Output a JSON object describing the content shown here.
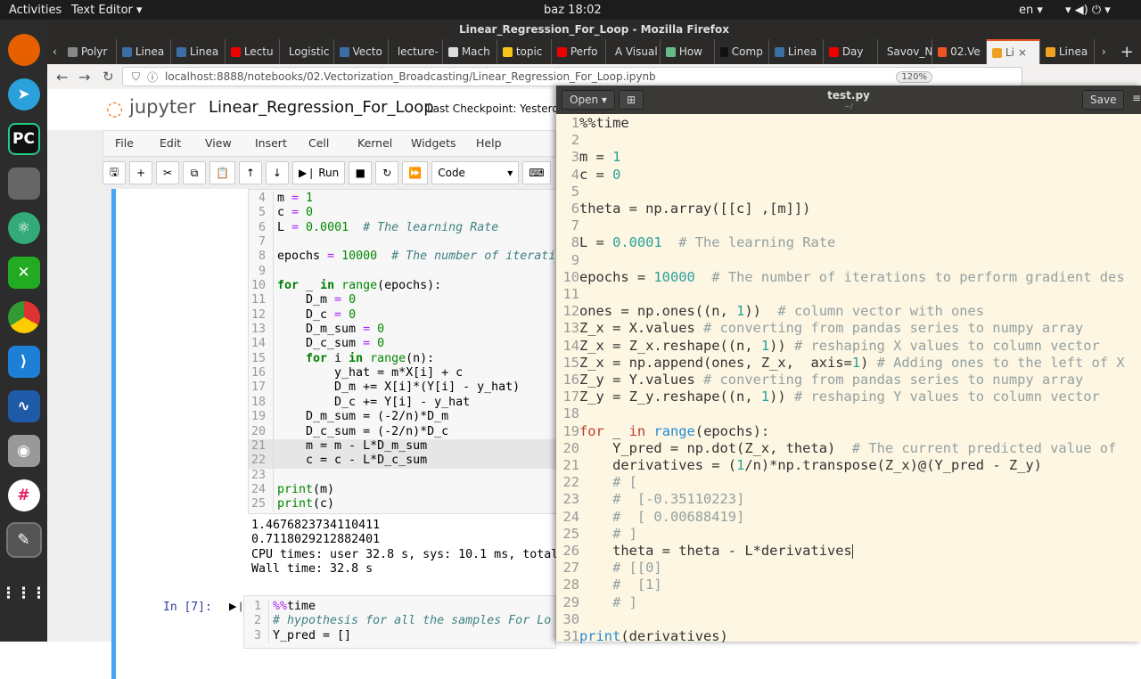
{
  "topbar": {
    "activities": "Activities",
    "app": "Text Editor ▾",
    "clock": "baz 18:02",
    "lang": "en ▾"
  },
  "firefox": {
    "title": "Linear_Regression_For_Loop - Mozilla Firefox",
    "tabs": [
      "Polyr",
      "Linea",
      "Linea",
      "Lectu",
      "Logistic",
      "Vecto",
      "lecture-",
      "Mach",
      "topic",
      "Perfo",
      "A Visual",
      "How",
      "Comp",
      "Linea",
      "Day",
      "Savov_N",
      "02.Ve",
      "Li",
      "Linea"
    ],
    "tab_colors": [
      "#888",
      "#3a6ea5",
      "#3a6ea5",
      "#e00",
      "#888",
      "#3a6ea5",
      "#888",
      "#ddd",
      "#f5c518",
      "#e00",
      "#888",
      "#6b8",
      "#111",
      "#3a6ea5",
      "#e00",
      "#888",
      "#e95420",
      "#f0a020",
      "#f0a020"
    ],
    "url": "localhost:8888/notebooks/02.Vectorization_Broadcasting/Linear_Regression_For_Loop.ipynb",
    "zoom": "120%"
  },
  "jupyter": {
    "logo": "jupyter",
    "notebook": "Linear_Regression_For_Loop",
    "checkpoint": "Last Checkpoint: Yesterda",
    "menu": [
      "File",
      "Edit",
      "View",
      "Insert",
      "Cell",
      "Kernel",
      "Widgets",
      "Help"
    ],
    "run": "Run",
    "cell_type": "Code",
    "cell_lines": [
      {
        "n": "4",
        "s": [
          [
            "",
            "m "
          ],
          [
            "jo",
            "="
          ],
          [
            "",
            " "
          ],
          [
            "jn",
            "1"
          ]
        ]
      },
      {
        "n": "5",
        "s": [
          [
            "",
            "c "
          ],
          [
            "jo",
            "="
          ],
          [
            "",
            " "
          ],
          [
            "jn",
            "0"
          ]
        ]
      },
      {
        "n": "6",
        "s": [
          [
            "",
            "L "
          ],
          [
            "jo",
            "="
          ],
          [
            "",
            " "
          ],
          [
            "jn",
            "0.0001"
          ],
          [
            "",
            "  "
          ],
          [
            "jc",
            "# The learning Rate"
          ]
        ]
      },
      {
        "n": "7",
        "s": []
      },
      {
        "n": "8",
        "s": [
          [
            "",
            "epochs "
          ],
          [
            "jo",
            "="
          ],
          [
            "",
            " "
          ],
          [
            "jn",
            "10000"
          ],
          [
            "",
            "  "
          ],
          [
            "jc",
            "# The number of iterati"
          ]
        ]
      },
      {
        "n": "9",
        "s": []
      },
      {
        "n": "10",
        "s": [
          [
            "jk",
            "for"
          ],
          [
            "",
            " _ "
          ],
          [
            "jk",
            "in"
          ],
          [
            "",
            " "
          ],
          [
            "jn",
            "range"
          ],
          [
            "",
            "(epochs):"
          ]
        ]
      },
      {
        "n": "11",
        "s": [
          [
            "",
            "    D_m "
          ],
          [
            "jo",
            "="
          ],
          [
            "",
            " "
          ],
          [
            "jn",
            "0"
          ]
        ]
      },
      {
        "n": "12",
        "s": [
          [
            "",
            "    D_c "
          ],
          [
            "jo",
            "="
          ],
          [
            "",
            " "
          ],
          [
            "jn",
            "0"
          ]
        ]
      },
      {
        "n": "13",
        "s": [
          [
            "",
            "    D_m_sum "
          ],
          [
            "jo",
            "="
          ],
          [
            "",
            " "
          ],
          [
            "jn",
            "0"
          ]
        ]
      },
      {
        "n": "14",
        "s": [
          [
            "",
            "    D_c_sum "
          ],
          [
            "jo",
            "="
          ],
          [
            "",
            " "
          ],
          [
            "jn",
            "0"
          ]
        ]
      },
      {
        "n": "15",
        "s": [
          [
            "",
            "    "
          ],
          [
            "jk",
            "for"
          ],
          [
            "",
            " i "
          ],
          [
            "jk",
            "in"
          ],
          [
            "",
            " "
          ],
          [
            "jn",
            "range"
          ],
          [
            "",
            "(n):"
          ]
        ]
      },
      {
        "n": "16",
        "s": [
          [
            "",
            "        y_hat = m*X[i] + c"
          ]
        ]
      },
      {
        "n": "17",
        "s": [
          [
            "",
            "        D_m += X[i]*(Y[i] - y_hat)"
          ]
        ]
      },
      {
        "n": "18",
        "s": [
          [
            "",
            "        D_c += Y[i] - y_hat"
          ]
        ]
      },
      {
        "n": "19",
        "s": [
          [
            "",
            "    D_m_sum = (-2/n)*D_m"
          ]
        ]
      },
      {
        "n": "20",
        "s": [
          [
            "",
            "    D_c_sum = (-2/n)*D_c"
          ]
        ]
      },
      {
        "n": "21",
        "s": [
          [
            "",
            "    m = m - L*D_m_sum"
          ]
        ],
        "hl": true
      },
      {
        "n": "22",
        "s": [
          [
            "",
            "    c = c - L*D_c_sum"
          ]
        ],
        "hl": true
      },
      {
        "n": "23",
        "s": []
      },
      {
        "n": "24",
        "s": [
          [
            "jn",
            "print"
          ],
          [
            "",
            "(m)"
          ]
        ]
      },
      {
        "n": "25",
        "s": [
          [
            "jn",
            "print"
          ],
          [
            "",
            "(c)"
          ]
        ]
      }
    ],
    "output": [
      "1.4676823734110411",
      "0.7118029212882401",
      "CPU times: user 32.8 s, sys: 10.1 ms, total",
      "Wall time: 32.8 s"
    ],
    "next_prompt": "In [7]:",
    "next_lines": [
      {
        "n": "1",
        "s": [
          [
            "jo",
            "%%"
          ],
          [
            "",
            "time"
          ]
        ]
      },
      {
        "n": "2",
        "s": [
          [
            "jc",
            "# hypothesis for all the samples For Lo"
          ]
        ]
      },
      {
        "n": "3",
        "s": [
          [
            "",
            "Y_pred = []"
          ]
        ]
      }
    ]
  },
  "editor": {
    "open": "Open ▾",
    "filename": "test.py",
    "path": "~/",
    "save": "Save",
    "lines": [
      [
        [
          "",
          "%%time"
        ]
      ],
      [],
      [
        [
          "",
          "m = "
        ],
        [
          "n",
          "1"
        ]
      ],
      [
        [
          "",
          "c = "
        ],
        [
          "n",
          "0"
        ]
      ],
      [],
      [
        [
          "",
          "theta = np.array([[c] ,[m]])"
        ]
      ],
      [],
      [
        [
          "",
          "L = "
        ],
        [
          "n",
          "0.0001"
        ],
        [
          "",
          "  "
        ],
        [
          "c",
          "# The learning Rate"
        ]
      ],
      [],
      [
        [
          "",
          "epochs = "
        ],
        [
          "n",
          "10000"
        ],
        [
          "",
          "  "
        ],
        [
          "c",
          "# The number of iterations to perform gradient des"
        ]
      ],
      [],
      [
        [
          "",
          "ones = np.ones((n, "
        ],
        [
          "n",
          "1"
        ],
        [
          "",
          "))  "
        ],
        [
          "c",
          "# column vector with ones"
        ]
      ],
      [
        [
          "",
          "Z_x = X.values "
        ],
        [
          "c",
          "# converting from pandas series to numpy array"
        ]
      ],
      [
        [
          "",
          "Z_x = Z_x.reshape((n, "
        ],
        [
          "n",
          "1"
        ],
        [
          "",
          ")) "
        ],
        [
          "c",
          "# reshaping X values to column vector"
        ]
      ],
      [
        [
          "",
          "Z_x = np.append(ones, Z_x,  axis="
        ],
        [
          "n",
          "1"
        ],
        [
          "",
          ") "
        ],
        [
          "c",
          "# Adding ones to the left of X"
        ]
      ],
      [
        [
          "",
          "Z_y = Y.values "
        ],
        [
          "c",
          "# converting from pandas series to numpy array"
        ]
      ],
      [
        [
          "",
          "Z_y = Z_y.reshape((n, "
        ],
        [
          "n",
          "1"
        ],
        [
          "",
          ")) "
        ],
        [
          "c",
          "# reshaping Y values to column vector"
        ]
      ],
      [],
      [
        [
          "k",
          "for"
        ],
        [
          "",
          " _ "
        ],
        [
          "k",
          "in"
        ],
        [
          "",
          " "
        ],
        [
          "b",
          "range"
        ],
        [
          "",
          "(epochs):"
        ]
      ],
      [
        [
          "",
          "    Y_pred = np.dot(Z_x, theta)  "
        ],
        [
          "c",
          "# The current predicted value of"
        ]
      ],
      [
        [
          "",
          "    derivatives = ("
        ],
        [
          "n",
          "1"
        ],
        [
          "",
          "/n)*np.transpose(Z_x)@(Y_pred - Z_y)"
        ]
      ],
      [
        [
          "",
          "    "
        ],
        [
          "c",
          "# ["
        ]
      ],
      [
        [
          "",
          "    "
        ],
        [
          "c",
          "#  [-0.35110223]"
        ]
      ],
      [
        [
          "",
          "    "
        ],
        [
          "c",
          "#  [ 0.00688419]"
        ]
      ],
      [
        [
          "",
          "    "
        ],
        [
          "c",
          "# ]"
        ]
      ],
      [
        [
          "",
          "    theta = theta - L*derivatives"
        ]
      ],
      [
        [
          "",
          "    "
        ],
        [
          "c",
          "# [[0]"
        ]
      ],
      [
        [
          "",
          "    "
        ],
        [
          "c",
          "#  [1]"
        ]
      ],
      [
        [
          "",
          "    "
        ],
        [
          "c",
          "# ]"
        ]
      ],
      [],
      [
        [
          "b",
          "print"
        ],
        [
          "",
          "(derivatives)"
        ]
      ]
    ]
  }
}
